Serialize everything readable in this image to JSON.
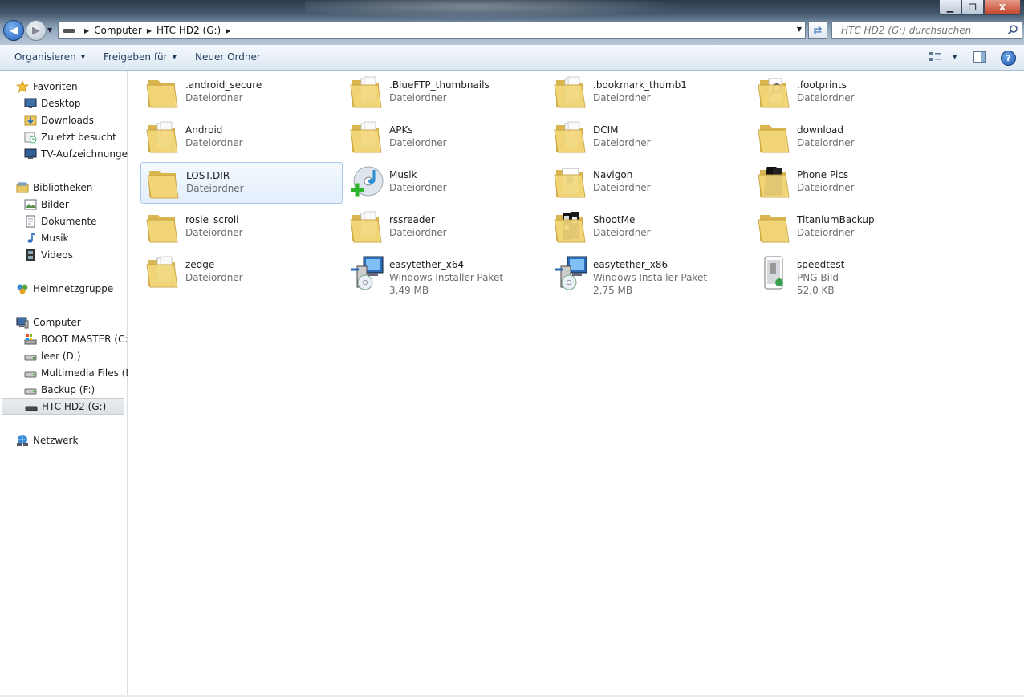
{
  "window": {
    "buttons": {
      "minimize": "▁",
      "maximize": "❐",
      "close": "X"
    }
  },
  "address": {
    "segments": [
      "Computer",
      "HTC HD2 (G:)"
    ]
  },
  "search": {
    "placeholder": "HTC HD2 (G:) durchsuchen"
  },
  "toolbar": {
    "organize": "Organisieren",
    "share": "Freigeben für",
    "new_folder": "Neuer Ordner",
    "help": "?"
  },
  "sidebar": {
    "favorites": {
      "label": "Favoriten",
      "items": [
        "Desktop",
        "Downloads",
        "Zuletzt besucht",
        "TV-Aufzeichnungen"
      ]
    },
    "libraries": {
      "label": "Bibliotheken",
      "items": [
        "Bilder",
        "Dokumente",
        "Musik",
        "Videos"
      ]
    },
    "homegroup": {
      "label": "Heimnetzgruppe"
    },
    "computer": {
      "label": "Computer",
      "drives": [
        "BOOT MASTER (C:)",
        "leer (D:)",
        "Multimedia Files (E:)",
        "Backup (F:)",
        "HTC HD2 (G:)"
      ],
      "selected": "HTC HD2 (G:)"
    },
    "network": {
      "label": "Netzwerk"
    }
  },
  "files": [
    {
      "name": ".android_secure",
      "type": "Dateiordner",
      "icon": "folder-icon"
    },
    {
      "name": ".BlueFTP_thumbnails",
      "type": "Dateiordner",
      "icon": "folder-docs-icon"
    },
    {
      "name": ".bookmark_thumb1",
      "type": "Dateiordner",
      "icon": "folder-docs-icon"
    },
    {
      "name": ".footprints",
      "type": "Dateiordner",
      "icon": "folder-search-icon"
    },
    {
      "name": "Android",
      "type": "Dateiordner",
      "icon": "folder-docs-icon"
    },
    {
      "name": "APKs",
      "type": "Dateiordner",
      "icon": "folder-docs-icon"
    },
    {
      "name": "DCIM",
      "type": "Dateiordner",
      "icon": "folder-docs-icon"
    },
    {
      "name": "download",
      "type": "Dateiordner",
      "icon": "folder-icon"
    },
    {
      "name": "LOST.DIR",
      "type": "Dateiordner",
      "icon": "folder-icon",
      "selected": true
    },
    {
      "name": "Musik",
      "type": "Dateiordner",
      "icon": "music-cd-add-icon"
    },
    {
      "name": "Navigon",
      "type": "Dateiordner",
      "icon": "folder-doc-image-icon"
    },
    {
      "name": "Phone Pics",
      "type": "Dateiordner",
      "icon": "folder-black-icon"
    },
    {
      "name": "rosie_scroll",
      "type": "Dateiordner",
      "icon": "folder-icon"
    },
    {
      "name": "rssreader",
      "type": "Dateiordner",
      "icon": "folder-docs-icon"
    },
    {
      "name": "ShootMe",
      "type": "Dateiordner",
      "icon": "folder-film-icon"
    },
    {
      "name": "TitaniumBackup",
      "type": "Dateiordner",
      "icon": "folder-icon"
    },
    {
      "name": "zedge",
      "type": "Dateiordner",
      "icon": "folder-docs-icon"
    },
    {
      "name": "easytether_x64",
      "type": "Windows Installer-Paket",
      "size": "3,49 MB",
      "icon": "installer-icon"
    },
    {
      "name": "easytether_x86",
      "type": "Windows Installer-Paket",
      "size": "2,75 MB",
      "icon": "installer-icon"
    },
    {
      "name": "speedtest",
      "type": "PNG-Bild",
      "size": "52,0 KB",
      "icon": "image-file-icon"
    }
  ],
  "colors": {
    "selection_bg": "#e2eefb",
    "selection_border": "#a9c7ea",
    "toolbar_text": "#1e395b",
    "secondary_text": "#6d6d6d"
  }
}
